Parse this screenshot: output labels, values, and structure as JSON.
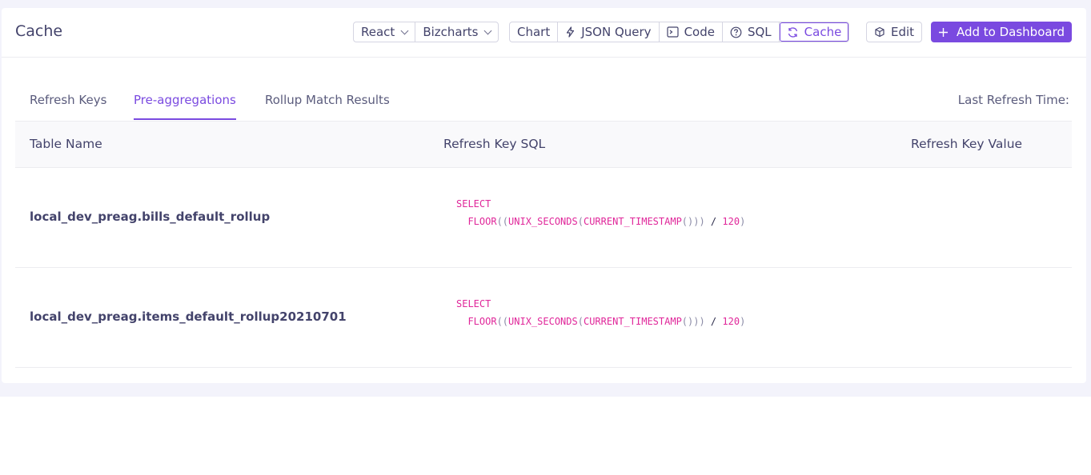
{
  "header": {
    "title": "Cache",
    "framework": "React",
    "library": "Bizcharts",
    "tabs": [
      "Chart",
      "JSON Query",
      "Code",
      "SQL",
      "Cache"
    ],
    "edit_label": "Edit",
    "add_label": "Add to Dashboard"
  },
  "subtabs": {
    "items": [
      "Refresh Keys",
      "Pre-aggregations",
      "Rollup Match Results"
    ],
    "active": "Pre-aggregations",
    "last_refresh_label": "Last Refresh Time:"
  },
  "table": {
    "columns": [
      "Table Name",
      "Refresh Key SQL",
      "Refresh Key Value"
    ],
    "rows": [
      {
        "table_name": "local_dev_preag.bills_default_rollup",
        "sql_select": "SELECT",
        "sql_floor": "FLOOR",
        "sql_unix": "UNIX_SECONDS",
        "sql_ts": "CURRENT_TIMESTAMP",
        "sql_div": "/",
        "sql_num": "120",
        "value": ""
      },
      {
        "table_name": "local_dev_preag.items_default_rollup20210701",
        "sql_select": "SELECT",
        "sql_floor": "FLOOR",
        "sql_unix": "UNIX_SECONDS",
        "sql_ts": "CURRENT_TIMESTAMP",
        "sql_div": "/",
        "sql_num": "120",
        "value": ""
      }
    ]
  },
  "colors": {
    "accent": "#7a4ae0",
    "sql_keyword": "#e0279a"
  }
}
